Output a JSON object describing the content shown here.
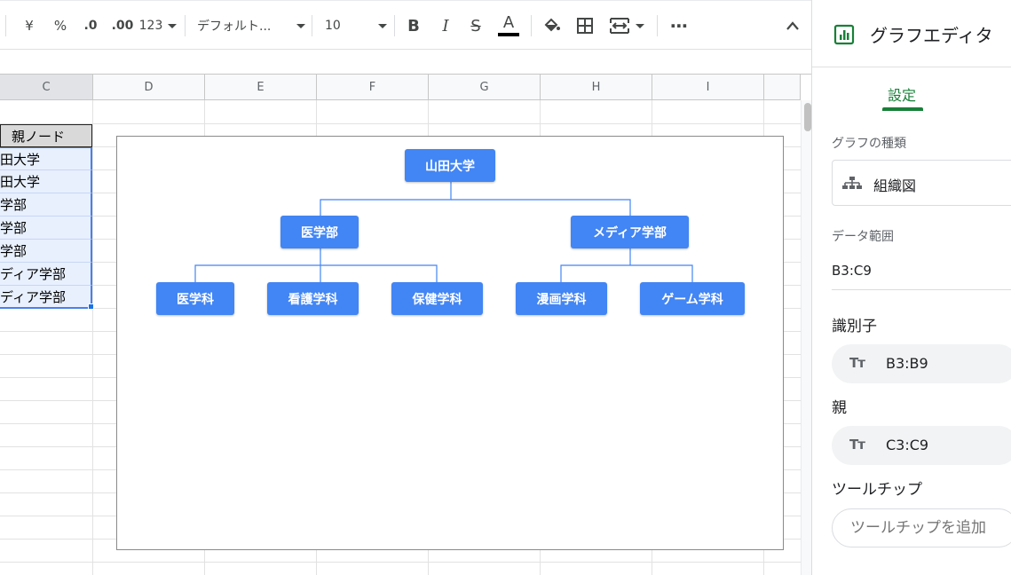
{
  "toolbar": {
    "currency": "¥",
    "percent": "%",
    "decrease_decimal": ".0",
    "increase_decimal": ".00",
    "more_formats": "123",
    "font_family": "デフォルト...",
    "font_size": "10",
    "bold": "B",
    "italic": "I",
    "strike": "S",
    "text_color_letter": "A",
    "more": "⋯",
    "collapse": "^"
  },
  "columns": [
    "C",
    "D",
    "E",
    "F",
    "G",
    "H",
    "I"
  ],
  "cells": {
    "header": "親ノード",
    "rows": [
      "田大学",
      "田大学",
      "学部",
      "学部",
      "学部",
      "ディア学部",
      "ディア学部"
    ]
  },
  "chart_data": {
    "type": "org",
    "root": {
      "label": "山田大学",
      "children": [
        {
          "label": "医学部",
          "children": [
            {
              "label": "医学科"
            },
            {
              "label": "看護学科"
            },
            {
              "label": "保健学科"
            }
          ]
        },
        {
          "label": "メディア学部",
          "children": [
            {
              "label": "漫画学科"
            },
            {
              "label": "ゲーム学科"
            }
          ]
        }
      ]
    },
    "node_color": "#4285f4",
    "link_color": "#4285f4"
  },
  "panel": {
    "title": "グラフエディタ",
    "tab_setup": "設定",
    "chart_type_label": "グラフの種類",
    "chart_type_value": "組織図",
    "data_range_label": "データ範囲",
    "data_range_value": "B3:C9",
    "id_label": "識別子",
    "id_value": "B3:B9",
    "parent_label": "親",
    "parent_value": "C3:C9",
    "tooltip_label": "ツールチップ",
    "tooltip_placeholder": "ツールチップを追加",
    "tt_icon": "Tт"
  },
  "colors": {
    "accent_green": "#188038",
    "selection_blue": "#1a73e8"
  }
}
